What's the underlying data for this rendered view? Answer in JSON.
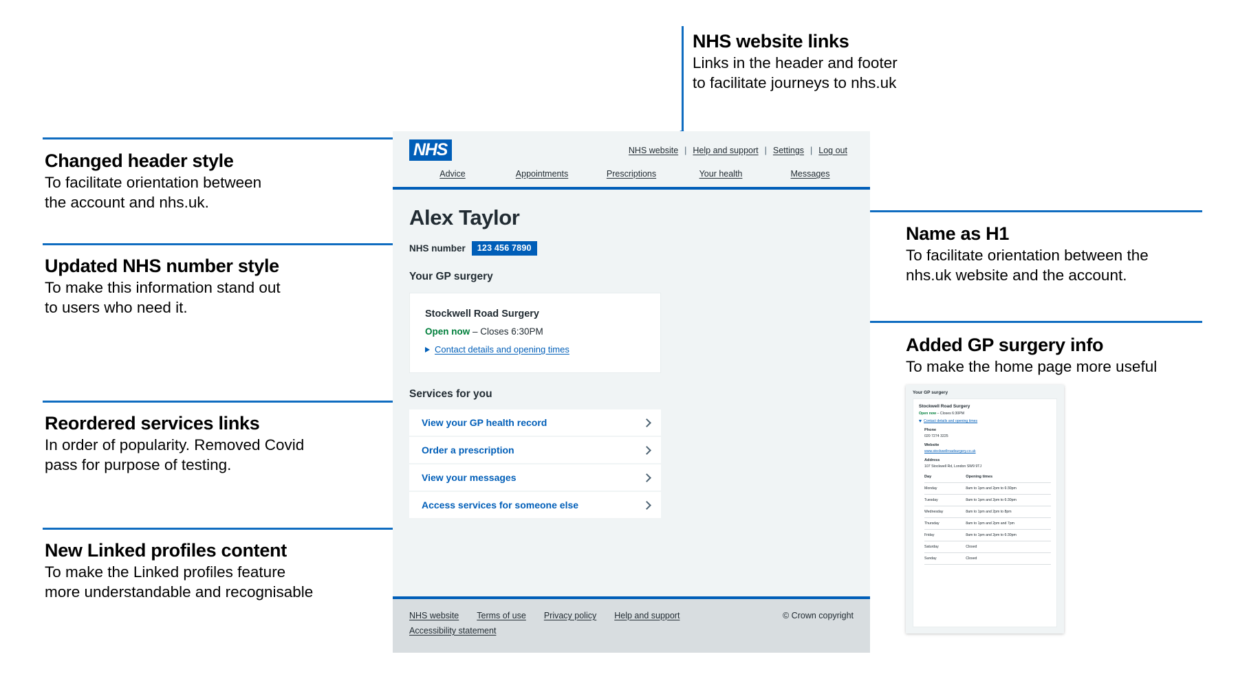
{
  "annotations": [
    {
      "id": "nhs-website-links",
      "title": "NHS website links",
      "body": "Links in the header and footer\nto facilitate journeys to nhs.uk"
    },
    {
      "id": "changed-header-style",
      "title": "Changed header style",
      "body": "To facilitate orientation between\nthe account and nhs.uk."
    },
    {
      "id": "updated-nhs-number-style",
      "title": "Updated NHS number style",
      "body": "To make this information stand out\nto users who need it."
    },
    {
      "id": "reordered-services-links",
      "title": "Reordered services links",
      "body": "In order of popularity. Removed Covid\npass for purpose of testing."
    },
    {
      "id": "new-linked-profiles-content",
      "title": "New Linked profiles content",
      "body": "To make the Linked profiles feature\nmore understandable and recognisable"
    },
    {
      "id": "name-as-h1",
      "title": "Name as H1",
      "body": "To facilitate orientation between the\nnhs.uk website and the account."
    },
    {
      "id": "added-gp-surgery-info",
      "title": "Added GP surgery info",
      "body": "To make the home page more useful"
    }
  ],
  "app": {
    "logo_text": "NHS",
    "header_links": [
      {
        "label": "NHS website"
      },
      {
        "label": "Help and support"
      },
      {
        "label": "Settings"
      },
      {
        "label": "Log out"
      }
    ],
    "header_separator": "|",
    "nav_items": [
      {
        "label": "Advice"
      },
      {
        "label": "Appointments"
      },
      {
        "label": "Prescriptions"
      },
      {
        "label": "Your health"
      },
      {
        "label": "Messages"
      }
    ],
    "user_name": "Alex Taylor",
    "nhs_number_label": "NHS number",
    "nhs_number_value": "123 456 7890",
    "gp_section_heading": "Your GP surgery",
    "gp": {
      "name": "Stockwell Road Surgery",
      "status_open": "Open now",
      "status_rest": " – Closes 6:30PM",
      "details_link": "Contact details and opening times"
    },
    "services_heading": "Services for you",
    "services": [
      {
        "label": "View your GP health record"
      },
      {
        "label": "Order a prescription"
      },
      {
        "label": "View your messages"
      },
      {
        "label": "Access services for someone else"
      }
    ],
    "footer_links_row1": [
      {
        "label": "NHS website"
      },
      {
        "label": "Terms of use"
      },
      {
        "label": "Privacy policy"
      },
      {
        "label": "Help and support"
      }
    ],
    "footer_links_row2": [
      {
        "label": "Accessibility statement"
      }
    ],
    "copyright": "© Crown copyright"
  },
  "mini_card": {
    "heading": "Your GP surgery",
    "gp_name": "Stockwell Road Surgery",
    "status_open": "Open now",
    "status_rest": " – Closes 6:30PM",
    "details_link": "Contact details and opening times",
    "phone_label": "Phone",
    "phone_value": "020 7274 3225",
    "website_label": "Website",
    "website_value": "www.stockwellroadsurgery.co.uk",
    "address_label": "Address",
    "address_value": "107 Stockwell Rd, London SW9 9TJ",
    "table_headers": [
      "Day",
      "Opening times"
    ],
    "opening_times": [
      {
        "day": "Monday",
        "times": "8am to 1pm and 2pm to 6:30pm"
      },
      {
        "day": "Tuesday",
        "times": "8am to 1pm and 2pm to 6:30pm"
      },
      {
        "day": "Wednesday",
        "times": "8am to 1pm and 2pm to 8pm"
      },
      {
        "day": "Thursday",
        "times": "8am to 1pm and 2pm and 7pm"
      },
      {
        "day": "Friday",
        "times": "8am to 1pm and 2pm to 6:30pm"
      },
      {
        "day": "Saturday",
        "times": "Closed"
      },
      {
        "day": "Sunday",
        "times": "Closed"
      }
    ]
  },
  "colors": {
    "nhs_blue": "#005eb8",
    "annotation_blue": "#0f6cc0",
    "green": "#007f3b",
    "pale_grey": "#f0f4f5",
    "footer_grey": "#d8dde0",
    "ink": "#212b32"
  }
}
